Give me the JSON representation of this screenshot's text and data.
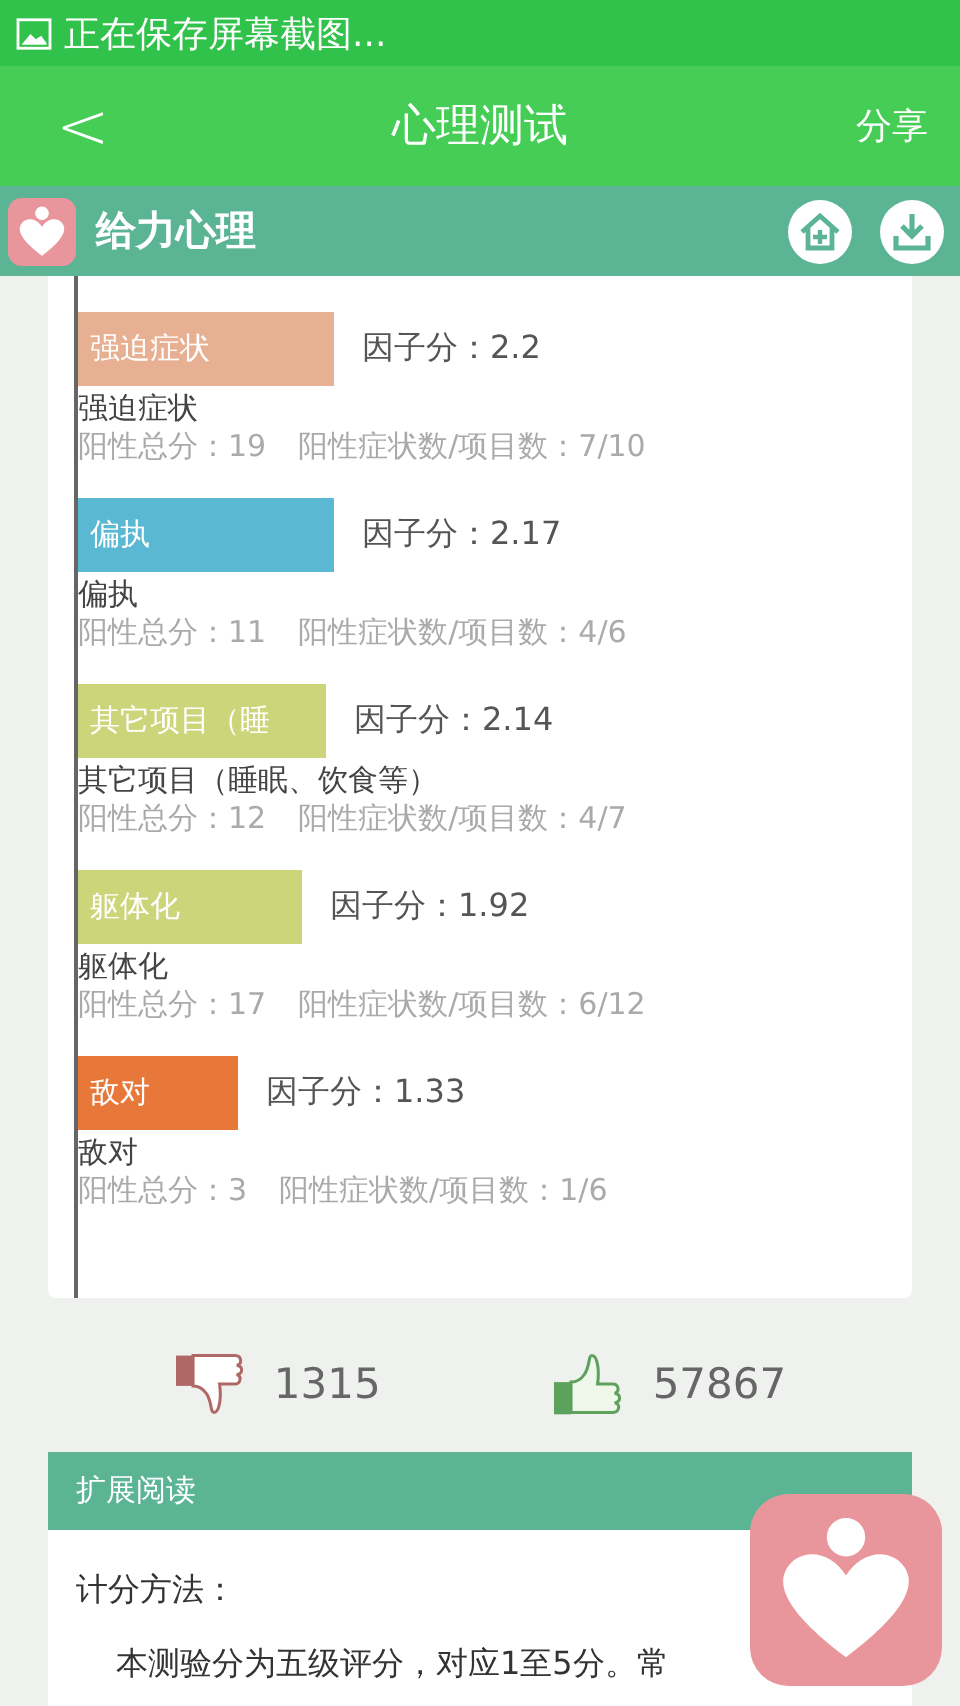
{
  "status_bar": {
    "text": "正在保存屏幕截图..."
  },
  "nav": {
    "back": "<",
    "title": "心理测试",
    "share": "分享"
  },
  "app_bar": {
    "title": "给力心理"
  },
  "factors": [
    {
      "bar_label": "强迫症状",
      "score": "因子分：2.2",
      "name": "强迫症状",
      "total": "阳性总分：19",
      "ratio": "阳性症状数/项目数：7/10",
      "color": "#e8b092"
    },
    {
      "bar_label": "偏执",
      "score": "因子分：2.17",
      "name": "偏执",
      "total": "阳性总分：11",
      "ratio": "阳性症状数/项目数：4/6",
      "color": "#5bb8d2"
    },
    {
      "bar_label": "其它项目（睡",
      "score": "因子分：2.14",
      "name": "其它项目（睡眠、饮食等）",
      "total": "阳性总分：12",
      "ratio": "阳性症状数/项目数：4/7",
      "color": "#cdd57a"
    },
    {
      "bar_label": "躯体化",
      "score": "因子分：1.92",
      "name": "躯体化",
      "total": "阳性总分：17",
      "ratio": "阳性症状数/项目数：6/12",
      "color": "#cdd57a"
    },
    {
      "bar_label": "敌对",
      "score": "因子分：1.33",
      "name": "敌对",
      "total": "阳性总分：3",
      "ratio": "阳性症状数/项目数：1/6",
      "color": "#e8773a"
    }
  ],
  "votes": {
    "dislikes": "1315",
    "likes": "57867"
  },
  "reading": {
    "header": "扩展阅读",
    "heading": "计分方法：",
    "text": "本测验分为五级评分，对应1至5分。常"
  }
}
